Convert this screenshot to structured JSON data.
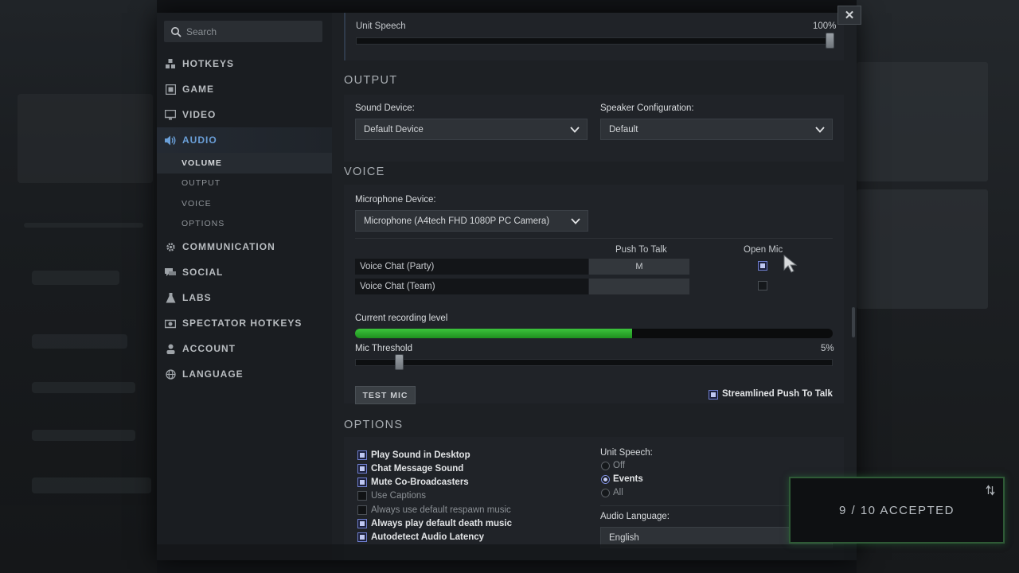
{
  "search": {
    "placeholder": "Search"
  },
  "close_label": "✕",
  "sidebar": {
    "items": [
      {
        "label": "HOTKEYS",
        "icon": "grid-icon"
      },
      {
        "label": "GAME",
        "icon": "game-icon"
      },
      {
        "label": "VIDEO",
        "icon": "monitor-icon"
      },
      {
        "label": "AUDIO",
        "icon": "speaker-icon",
        "active": true
      },
      {
        "label": "COMMUNICATION",
        "icon": "gear-icon"
      },
      {
        "label": "SOCIAL",
        "icon": "chat-icon"
      },
      {
        "label": "LABS",
        "icon": "flask-icon"
      },
      {
        "label": "SPECTATOR HOTKEYS",
        "icon": "camera-icon"
      },
      {
        "label": "ACCOUNT",
        "icon": "user-icon"
      },
      {
        "label": "LANGUAGE",
        "icon": "globe-icon"
      }
    ],
    "audio_sub": [
      "VOLUME",
      "OUTPUT",
      "VOICE",
      "OPTIONS"
    ]
  },
  "volume": {
    "unit_speech_label": "Unit Speech",
    "unit_speech_value": "100%",
    "unit_speech_level": 1.0
  },
  "output": {
    "title": "OUTPUT",
    "sound_device_label": "Sound Device:",
    "sound_device_value": "Default Device",
    "speaker_config_label": "Speaker Configuration:",
    "speaker_config_value": "Default"
  },
  "voice": {
    "title": "VOICE",
    "mic_device_label": "Microphone Device:",
    "mic_device_value": "Microphone (A4tech FHD 1080P PC Camera)",
    "col_push_to_talk": "Push To Talk",
    "col_open_mic": "Open Mic",
    "rows": [
      {
        "label": "Voice Chat (Party)",
        "key": "M",
        "open_mic": true
      },
      {
        "label": "Voice Chat (Team)",
        "key": "",
        "open_mic": false
      }
    ],
    "recording_level_label": "Current recording level",
    "recording_level": 0.58,
    "mic_threshold_label": "Mic Threshold",
    "mic_threshold_value": "5%",
    "mic_threshold_level": 0.05,
    "test_mic_label": "TEST MIC",
    "streamlined_label": "Streamlined Push To Talk",
    "streamlined_checked": true
  },
  "options": {
    "title": "OPTIONS",
    "checks": [
      {
        "label": "Play Sound in Desktop",
        "checked": true
      },
      {
        "label": "Chat Message Sound",
        "checked": true
      },
      {
        "label": "Mute Co-Broadcasters",
        "checked": true
      },
      {
        "label": "Use Captions",
        "checked": false
      },
      {
        "label": "Always use default respawn music",
        "checked": false
      },
      {
        "label": "Always play default death music",
        "checked": true
      },
      {
        "label": "Autodetect Audio Latency",
        "checked": true
      }
    ],
    "unit_speech_label": "Unit Speech:",
    "unit_speech_options": [
      "Off",
      "Events",
      "All"
    ],
    "unit_speech_selected": "Events",
    "audio_language_label": "Audio Language:",
    "audio_language_value": "English"
  },
  "notification": {
    "accepted_text": "9 / 10  ACCEPTED"
  },
  "colors": {
    "accent": "#6a9fd8",
    "recording_bar": "#2fb52f",
    "accepted_border": "#2f5a36"
  }
}
